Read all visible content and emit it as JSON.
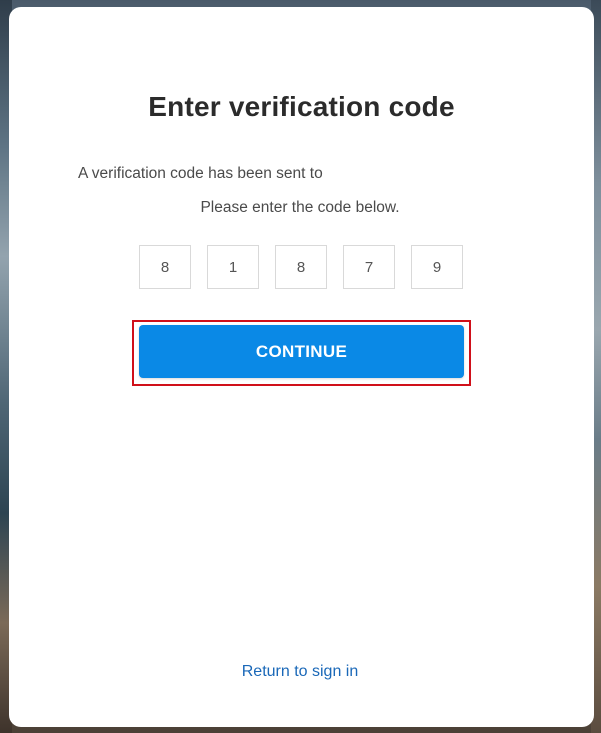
{
  "verify": {
    "title": "Enter verification code",
    "sent_to_text": "A verification code has been sent to",
    "instruction_text": "Please enter the code below.",
    "code_digits": [
      "8",
      "1",
      "8",
      "7",
      "9"
    ],
    "continue_label": "CONTINUE",
    "return_link": "Return to sign in"
  },
  "colors": {
    "primary_button": "#0a89e6",
    "highlight_border": "#d0101a",
    "link": "#1a68b8"
  }
}
